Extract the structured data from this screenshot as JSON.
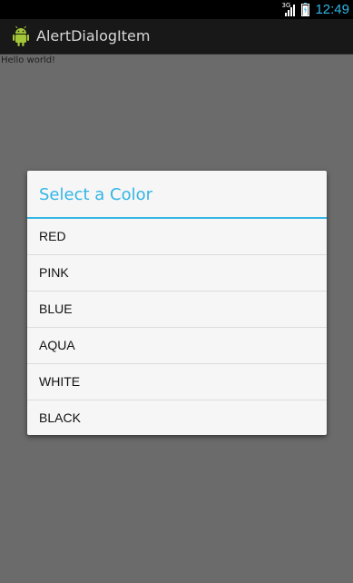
{
  "status_bar": {
    "network_type": "3G",
    "time": "12:49",
    "icons": [
      "signal-icon",
      "battery-icon"
    ]
  },
  "action_bar": {
    "app_icon": "android-robot-icon",
    "title": "AlertDialogItem"
  },
  "content": {
    "text": "Hello world!"
  },
  "dialog": {
    "title": "Select a Color",
    "items": [
      {
        "label": "RED"
      },
      {
        "label": "PINK"
      },
      {
        "label": "BLUE"
      },
      {
        "label": "AQUA"
      },
      {
        "label": "WHITE"
      },
      {
        "label": "BLACK"
      }
    ]
  },
  "colors": {
    "accent": "#33b5e5",
    "background": "#6b6b6b",
    "dialog_background": "#f6f6f6",
    "status_bar": "#000000",
    "action_bar": "#181818"
  }
}
